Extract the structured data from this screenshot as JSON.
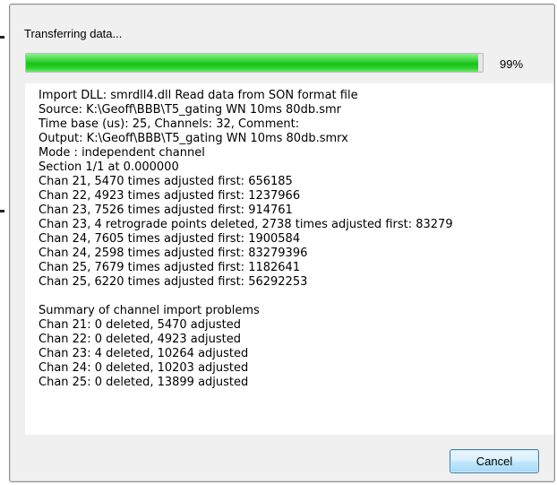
{
  "dialog": {
    "status_text": "Transferring data...",
    "progress": {
      "value_percent": 99,
      "label": "99%",
      "fill_color": "#1bbf1b"
    },
    "log_lines": [
      "Import DLL: smrdll4.dll Read data from SON format file",
      "Source: K:\\Geoff\\BBB\\T5_gating WN 10ms 80db.smr",
      "Time base (us): 25, Channels: 32, Comment:",
      "Output: K:\\Geoff\\BBB\\T5_gating WN 10ms 80db.smrx",
      "Mode  : independent channel",
      "Section 1/1 at 0.000000",
      "Chan 21, 5470 times adjusted first: 656185",
      "Chan 22, 4923 times adjusted first: 1237966",
      "Chan 23, 7526 times adjusted first: 914761",
      "Chan 23, 4 retrograde points deleted, 2738 times adjusted first: 83279",
      "Chan 24, 7605 times adjusted first: 1900584",
      "Chan 24, 2598 times adjusted first: 83279396",
      "Chan 25, 7679 times adjusted first: 1182641",
      "Chan 25, 6220 times adjusted first: 56292253",
      "",
      "Summary of channel import problems",
      "Chan 21: 0 deleted, 5470 adjusted",
      "Chan 22: 0 deleted, 4923 adjusted",
      "Chan 23: 4 deleted, 10264 adjusted",
      "Chan 24: 0 deleted, 10203 adjusted",
      "Chan 25: 0 deleted, 13899 adjusted"
    ],
    "cancel_label": "Cancel"
  }
}
